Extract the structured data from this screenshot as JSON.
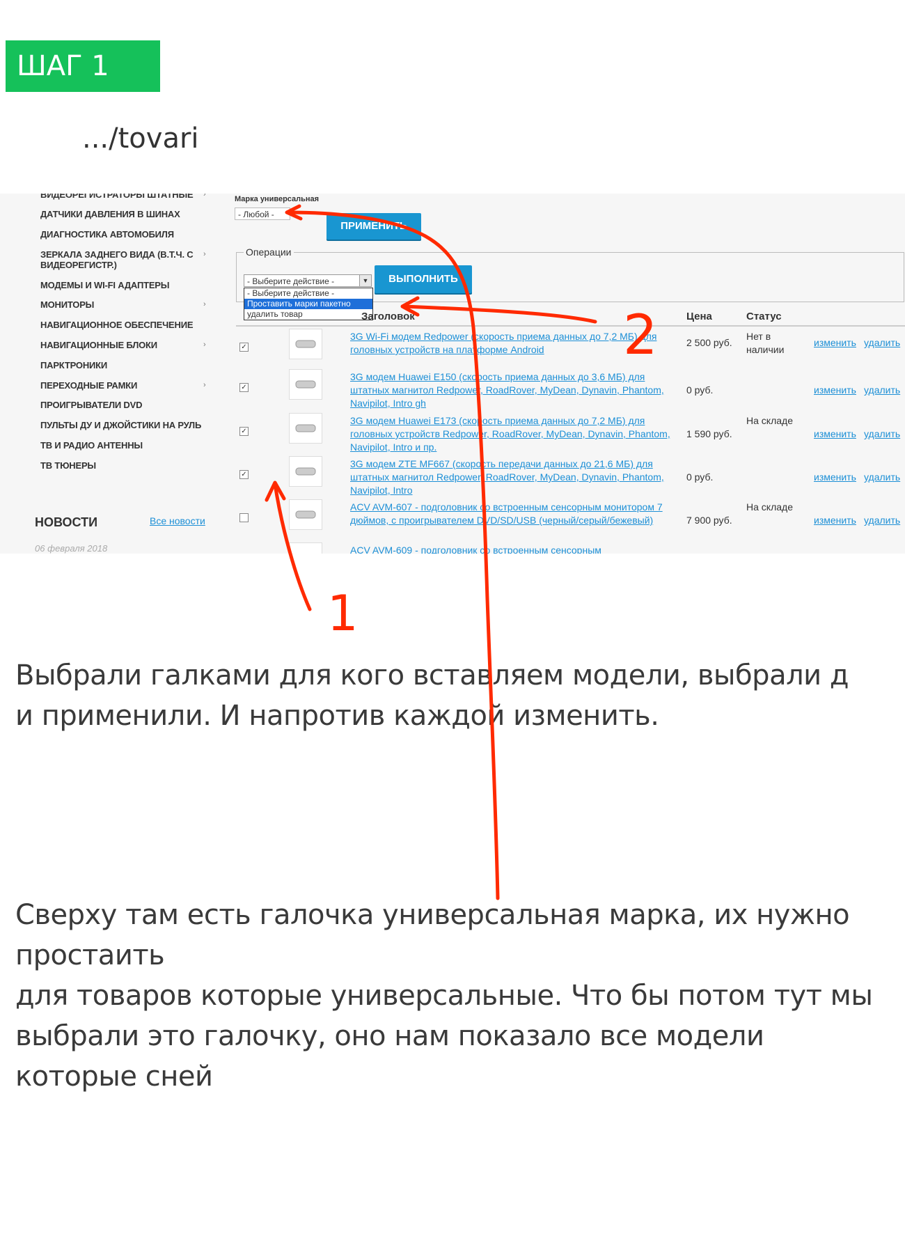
{
  "step_badge": "ШАГ 1",
  "path_label": ".../tovari",
  "sidebar": {
    "items": [
      {
        "label": "ВИДЕОРЕГИСТРАТОРЫ ШТАТНЫЕ",
        "has_arrow": true
      },
      {
        "label": "ДАТЧИКИ ДАВЛЕНИЯ В ШИНАХ",
        "has_arrow": false
      },
      {
        "label": "ДИАГНОСТИКА АВТОМОБИЛЯ",
        "has_arrow": false
      },
      {
        "label": "ЗЕРКАЛА ЗАДНЕГО ВИДА (В.Т.Ч. С ВИДЕОРЕГИСТР.)",
        "has_arrow": true
      },
      {
        "label": "МОДЕМЫ И WI-FI АДАПТЕРЫ",
        "has_arrow": false
      },
      {
        "label": "МОНИТОРЫ",
        "has_arrow": true
      },
      {
        "label": "НАВИГАЦИОННОЕ ОБЕСПЕЧЕНИЕ",
        "has_arrow": false
      },
      {
        "label": "НАВИГАЦИОННЫЕ БЛОКИ",
        "has_arrow": true
      },
      {
        "label": "ПАРКТРОНИКИ",
        "has_arrow": false
      },
      {
        "label": "ПЕРЕХОДНЫЕ РАМКИ",
        "has_arrow": true
      },
      {
        "label": "ПРОИГРЫВАТЕЛИ DVD",
        "has_arrow": false
      },
      {
        "label": "ПУЛЬТЫ ДУ И ДЖОЙСТИКИ НА РУЛЬ",
        "has_arrow": false
      },
      {
        "label": "ТВ И РАДИО АНТЕННЫ",
        "has_arrow": false
      },
      {
        "label": "ТВ ТЮНЕРЫ",
        "has_arrow": false
      }
    ],
    "arrow_glyph": "›",
    "news_title": "НОВОСТИ",
    "news_all": "Все новости",
    "news_date": "06 февраля 2018"
  },
  "filter": {
    "label": "Марка универсальная",
    "value": "- Любой -",
    "apply_button": "ПРИМЕНИТЬ"
  },
  "operations": {
    "legend": "Операции",
    "select_value": "- Выберите действие -",
    "execute_button": "ВЫПОЛНИТЬ",
    "options": [
      "- Выберите действие -",
      "Проставить марки пакетно",
      "удалить товар"
    ],
    "selected_index": 1
  },
  "table": {
    "headers": {
      "title": "Заголовок",
      "price": "Цена",
      "status": "Статус"
    },
    "edit_label": "изменить",
    "delete_label": "удалить",
    "rows": [
      {
        "checked": true,
        "title": "3G Wi-Fi модем Redpower (скорость приема данных до 7,2 МБ) для головных устройств на платформе Android",
        "price": "2 500 руб.",
        "status": "Нет в наличии"
      },
      {
        "checked": true,
        "title": "3G модем Huawei E150 (скорость приема данных до 3,6 МБ) для штатных магнитол Redpower, RoadRover, MyDean, Dynavin, Phantom, Navipilot, Intro gh",
        "price": "0 руб.",
        "status": ""
      },
      {
        "checked": true,
        "title": "3G модем Huawei E173 (скорость приема данных до 7,2 МБ) для головных устройств Redpower, RoadRover, MyDean, Dynavin, Phantom, Navipilot, Intro и пр.",
        "price": "1 590 руб.",
        "status": "На складе"
      },
      {
        "checked": true,
        "title": "3G модем ZTE MF667 (скорость передачи данных до 21,6 МБ) для штатных магнитол Redpower, RoadRover, MyDean, Dynavin, Phantom, Navipilot, Intro",
        "price": "0 руб.",
        "status": ""
      },
      {
        "checked": false,
        "title": "ACV AVM-607 - подголовник со встроенным сенсорным монитором 7 дюймов, с проигрывателем DVD/SD/USB (черный/серый/бежевый)",
        "price": "7 900 руб.",
        "status": "На складе"
      },
      {
        "checked": false,
        "title": "ACV AVM-609 - подголовник со встроенным сенсорным",
        "price": "",
        "status": ""
      }
    ]
  },
  "annotations": {
    "label_1": "1",
    "label_2": "2",
    "color": "#ff2a00"
  },
  "paragraph1_line1": "Выбрали галками для кого вставляем модели, выбрали д",
  "paragraph1_line2": "и применили. И напротив каждой изменить.",
  "paragraph2_line1": "Сверху там есть галочка универсальная марка, их нужно",
  "paragraph2_line2": "простаить",
  "paragraph2_line3": "для товаров которые универсальные. Что бы потом тут мы",
  "paragraph2_line4": "выбрали это галочку, оно нам показало все модели",
  "paragraph2_line5": "которые сней"
}
